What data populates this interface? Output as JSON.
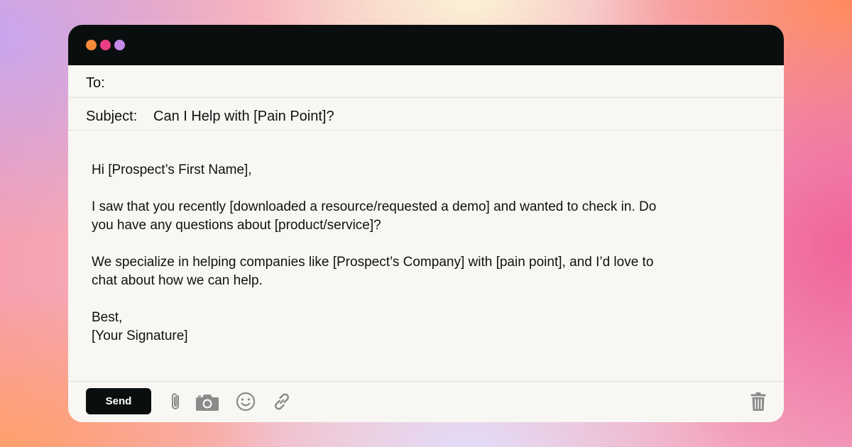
{
  "window": {
    "dots": [
      "#f6893a",
      "#ea3f86",
      "#c58ae6"
    ]
  },
  "fields": {
    "to_label": "To:",
    "to_value": "",
    "subject_label": "Subject:",
    "subject_value": "Can I Help with [Pain Point]?"
  },
  "body": {
    "greeting": "Hi [Prospect’s First Name],",
    "paragraph1_line1": "I saw that you recently [downloaded a resource/requested a demo] and wanted to check in. Do",
    "paragraph1_line2": "you have any questions about [product/service]?",
    "paragraph2_line1": "We specialize in helping companies like [Prospect’s Company] with [pain point], and I’d love to",
    "paragraph2_line2": "chat about how we can help.",
    "closing": "Best,",
    "signature": "[Your Signature]"
  },
  "toolbar": {
    "send_label": "Send",
    "icons": [
      "paperclip-icon",
      "camera-icon",
      "smiley-icon",
      "link-icon",
      "trash-icon"
    ]
  },
  "colors": {
    "titlebar": "#0b0e0e",
    "window_bg": "#f8f7f3",
    "icon": "#8a8a8a"
  }
}
